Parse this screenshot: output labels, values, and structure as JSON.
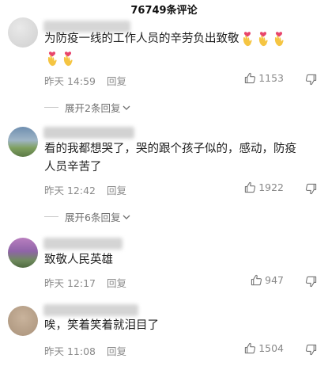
{
  "header": {
    "title": "76749条评论"
  },
  "comments": [
    {
      "text_lines": [
        "为防疫一线的工作人员的辛劳负出致敬"
      ],
      "time": "昨天 14:59",
      "reply_label": "回复",
      "likes": "1153",
      "expand": "展开2条回复"
    },
    {
      "text_lines": [
        "看的我都想哭了，哭的跟个孩子似的，感动，防疫",
        "人员辛苦了"
      ],
      "time": "昨天 12:42",
      "reply_label": "回复",
      "likes": "1922",
      "expand": "展开6条回复"
    },
    {
      "text_lines": [
        "致敬人民英雄"
      ],
      "time": "昨天 12:17",
      "reply_label": "回复",
      "likes": "947"
    },
    {
      "text_lines": [
        "唉，笑着笑着就泪目了"
      ],
      "time": "昨天 11:08",
      "reply_label": "回复",
      "likes": "1504"
    }
  ],
  "icons": {
    "like": "thumbs-up-icon",
    "dislike": "thumbs-down-icon",
    "expand": "chevron-down-icon",
    "heart_hands": "heart-hands-emoji"
  },
  "colors": {
    "text": "#1e1e1e",
    "meta": "#8a8a8a",
    "emoji": "#f5c542",
    "heart": "#e8456b"
  }
}
